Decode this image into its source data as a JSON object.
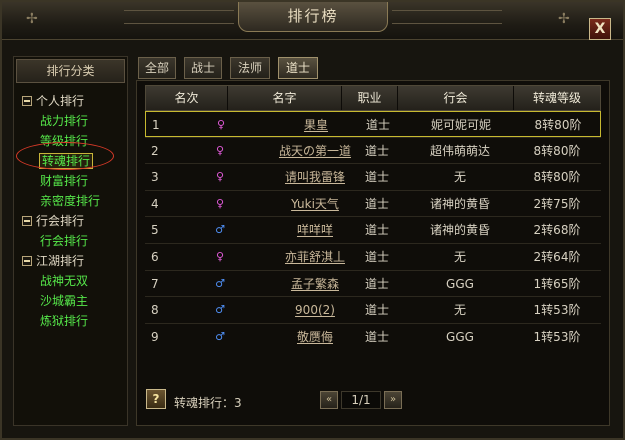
{
  "window": {
    "title": "排行榜",
    "close_label": "X"
  },
  "sidebar": {
    "header": "排行分类",
    "groups": [
      {
        "label": "个人排行",
        "items": [
          "战力排行",
          "等级排行",
          "转魂排行",
          "财富排行",
          "亲密度排行"
        ]
      },
      {
        "label": "行会排行",
        "items": [
          "行会排行"
        ]
      },
      {
        "label": "江湖排行",
        "items": [
          "战神无双",
          "沙城霸主",
          "炼狱排行"
        ]
      }
    ],
    "selected_item": "转魂排行"
  },
  "tabs": [
    {
      "label": "全部",
      "active": false
    },
    {
      "label": "战士",
      "active": false
    },
    {
      "label": "法师",
      "active": false
    },
    {
      "label": "道士",
      "active": true
    }
  ],
  "table": {
    "columns": [
      "名次",
      "名字",
      "职业",
      "行会",
      "转魂等级"
    ],
    "rows": [
      {
        "rank": "1",
        "gender": "♀",
        "name": "果皇",
        "job": "道士",
        "guild": "妮可妮可妮",
        "level": "8转80阶"
      },
      {
        "rank": "2",
        "gender": "♀",
        "name": "战天の第一道",
        "job": "道士",
        "guild": "超伟萌萌达",
        "level": "8转80阶"
      },
      {
        "rank": "3",
        "gender": "♀",
        "name": "请叫我雷锋",
        "job": "道士",
        "guild": "无",
        "level": "8转80阶"
      },
      {
        "rank": "4",
        "gender": "♀",
        "name": "Yuki天气",
        "job": "道士",
        "guild": "诸神的黄昏",
        "level": "2转75阶"
      },
      {
        "rank": "5",
        "gender": "♂",
        "name": "咩咩咩",
        "job": "道士",
        "guild": "诸神的黄昏",
        "level": "2转68阶"
      },
      {
        "rank": "6",
        "gender": "♀",
        "name": "亦菲舒淇丄",
        "job": "道士",
        "guild": "无",
        "level": "2转64阶"
      },
      {
        "rank": "7",
        "gender": "♂",
        "name": "孟子繁森",
        "job": "道士",
        "guild": "GGG",
        "level": "1转65阶"
      },
      {
        "rank": "8",
        "gender": "♂",
        "name": "900(2)",
        "job": "道士",
        "guild": "无",
        "level": "1转53阶"
      },
      {
        "rank": "9",
        "gender": "♂",
        "name": "敬赝侮",
        "job": "道士",
        "guild": "GGG",
        "level": "1转53阶"
      }
    ],
    "highlighted_rank": "1"
  },
  "footer": {
    "help_label": "?",
    "summary_label": "转魂排行：3",
    "prev_icon": "double-left-arrow",
    "next_icon": "double-right-arrow",
    "page": "1/1"
  },
  "colors": {
    "female": "#e05ad8",
    "male": "#4f8ef2",
    "nav_item": "#56e84a",
    "highlight_border": "#c7b930",
    "selection_ring": "#d83a28"
  }
}
